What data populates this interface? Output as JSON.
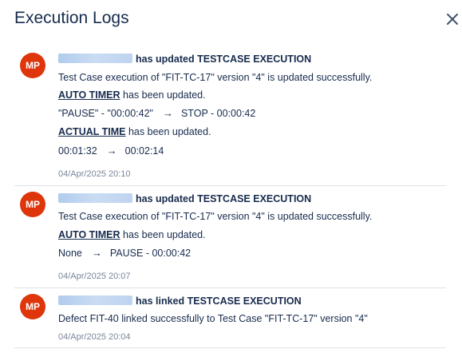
{
  "header": {
    "title": "Execution Logs",
    "close_icon": "close-icon"
  },
  "logs": [
    {
      "avatar": "MP",
      "action": "has updated TESTCASE EXECUTION",
      "message": "Test Case execution of \"FIT-TC-17\" version \"4\" is updated successfully.",
      "changes": [
        {
          "field": "AUTO TIMER",
          "suffix": "has been updated.",
          "from": "\"PAUSE\" - \"00:00:42\"",
          "to": "STOP - 00:00:42"
        },
        {
          "field": "ACTUAL TIME",
          "suffix": "has been updated.",
          "from": "00:01:32",
          "to": "00:02:14"
        }
      ],
      "timestamp": "04/Apr/2025 20:10"
    },
    {
      "avatar": "MP",
      "action": "has updated TESTCASE EXECUTION",
      "message": "Test Case execution of \"FIT-TC-17\" version \"4\" is updated successfully.",
      "changes": [
        {
          "field": "AUTO TIMER",
          "suffix": "has been updated.",
          "from": "None",
          "to": "PAUSE - 00:00:42"
        }
      ],
      "timestamp": "04/Apr/2025 20:07"
    },
    {
      "avatar": "MP",
      "action": "has linked TESTCASE EXECUTION",
      "message": "Defect FIT-40 linked successfully to Test Case \"FIT-TC-17\" version \"4\"",
      "changes": [],
      "timestamp": "04/Apr/2025 20:04"
    }
  ],
  "colors": {
    "avatar_bg": "#de350b",
    "text": "#172b4d",
    "timestamp": "#7a869a",
    "separator": "#dfe1e6"
  }
}
